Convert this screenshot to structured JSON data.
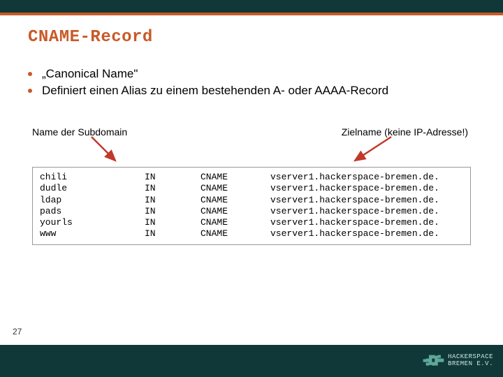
{
  "title": "CNAME-Record",
  "bullets": [
    "„Canonical Name\"",
    "Definiert einen Alias zu einem bestehenden A- oder AAAA-Record"
  ],
  "labels": {
    "subdomain": "Name der Subdomain",
    "target": "Zielname (keine IP-Adresse!)"
  },
  "records": [
    {
      "sub": "chili",
      "in": "IN",
      "type": "CNAME",
      "target": "vserver1.hackerspace-bremen.de."
    },
    {
      "sub": "dudle",
      "in": "IN",
      "type": "CNAME",
      "target": "vserver1.hackerspace-bremen.de."
    },
    {
      "sub": "ldap",
      "in": "IN",
      "type": "CNAME",
      "target": "vserver1.hackerspace-bremen.de."
    },
    {
      "sub": "pads",
      "in": "IN",
      "type": "CNAME",
      "target": "vserver1.hackerspace-bremen.de."
    },
    {
      "sub": "yourls",
      "in": "IN",
      "type": "CNAME",
      "target": "vserver1.hackerspace-bremen.de."
    },
    {
      "sub": "www",
      "in": "IN",
      "type": "CNAME",
      "target": "vserver1.hackerspace-bremen.de."
    }
  ],
  "page_number": "27",
  "logo": {
    "line1": "HACKERSPACE",
    "line2": "BREMEN E.V."
  },
  "colors": {
    "accent": "#c85a28",
    "dark": "#103838"
  }
}
